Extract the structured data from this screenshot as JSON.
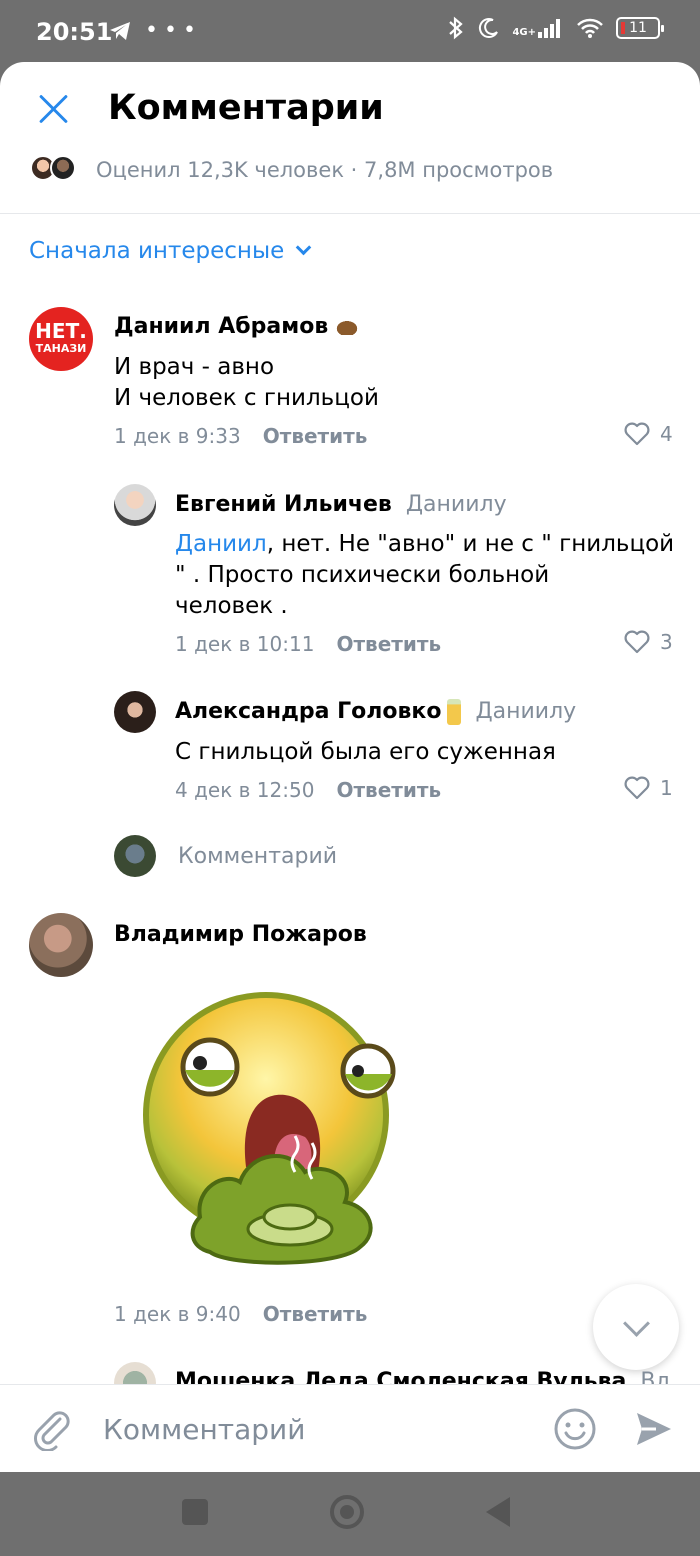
{
  "status_bar": {
    "time": "20:51",
    "left_icons": [
      "telegram-icon",
      "more-dots-icon"
    ],
    "network": "4G+",
    "battery": "11"
  },
  "header": {
    "title": "Комментарии",
    "likes_info": "Оценил 12,3K человек · 7,8M просмотров"
  },
  "sort": {
    "label": "Сначала интересные"
  },
  "comments": [
    {
      "author": "Даниил Абрамов",
      "avatar_text_1": "НЕТ.",
      "avatar_text_2": "ТАНАЗИ",
      "text_line1": "И врач - авно",
      "text_line2": "И человек с гнильцой",
      "date": "1 дек в 9:33",
      "reply_label": "Ответить",
      "likes": "4",
      "replies": [
        {
          "author": "Евгений Ильичев",
          "reply_to": "Даниилу",
          "mention": "Даниил",
          "text_line1_rest": ", нет. Не \"авно\" и не с \" гнильцой",
          "text_line2": "\" . Просто психически больной",
          "text_line3": "человек .",
          "date": "1 дек в 10:11",
          "reply_label": "Ответить",
          "likes": "3"
        },
        {
          "author": "Александра Головко",
          "reply_to": "Даниилу",
          "text": "С гнильцой была его суженная",
          "date": "4 дек в 12:50",
          "reply_label": "Ответить",
          "likes": "1"
        }
      ],
      "reply_field_placeholder": "Комментарий"
    },
    {
      "author": "Владимир Пожаров",
      "sticker": "vomiting-emoji-sticker",
      "date": "1 дек в 9:40",
      "reply_label": "Ответить"
    },
    {
      "author": "Мошенка Леда Смоленская Вульва",
      "reply_to_partial": "Вл"
    }
  ],
  "composer": {
    "placeholder": "Комментарий"
  },
  "colors": {
    "accent": "#2688eb",
    "secondary_text": "#818c99",
    "system_bar": "#6f6f6f"
  }
}
